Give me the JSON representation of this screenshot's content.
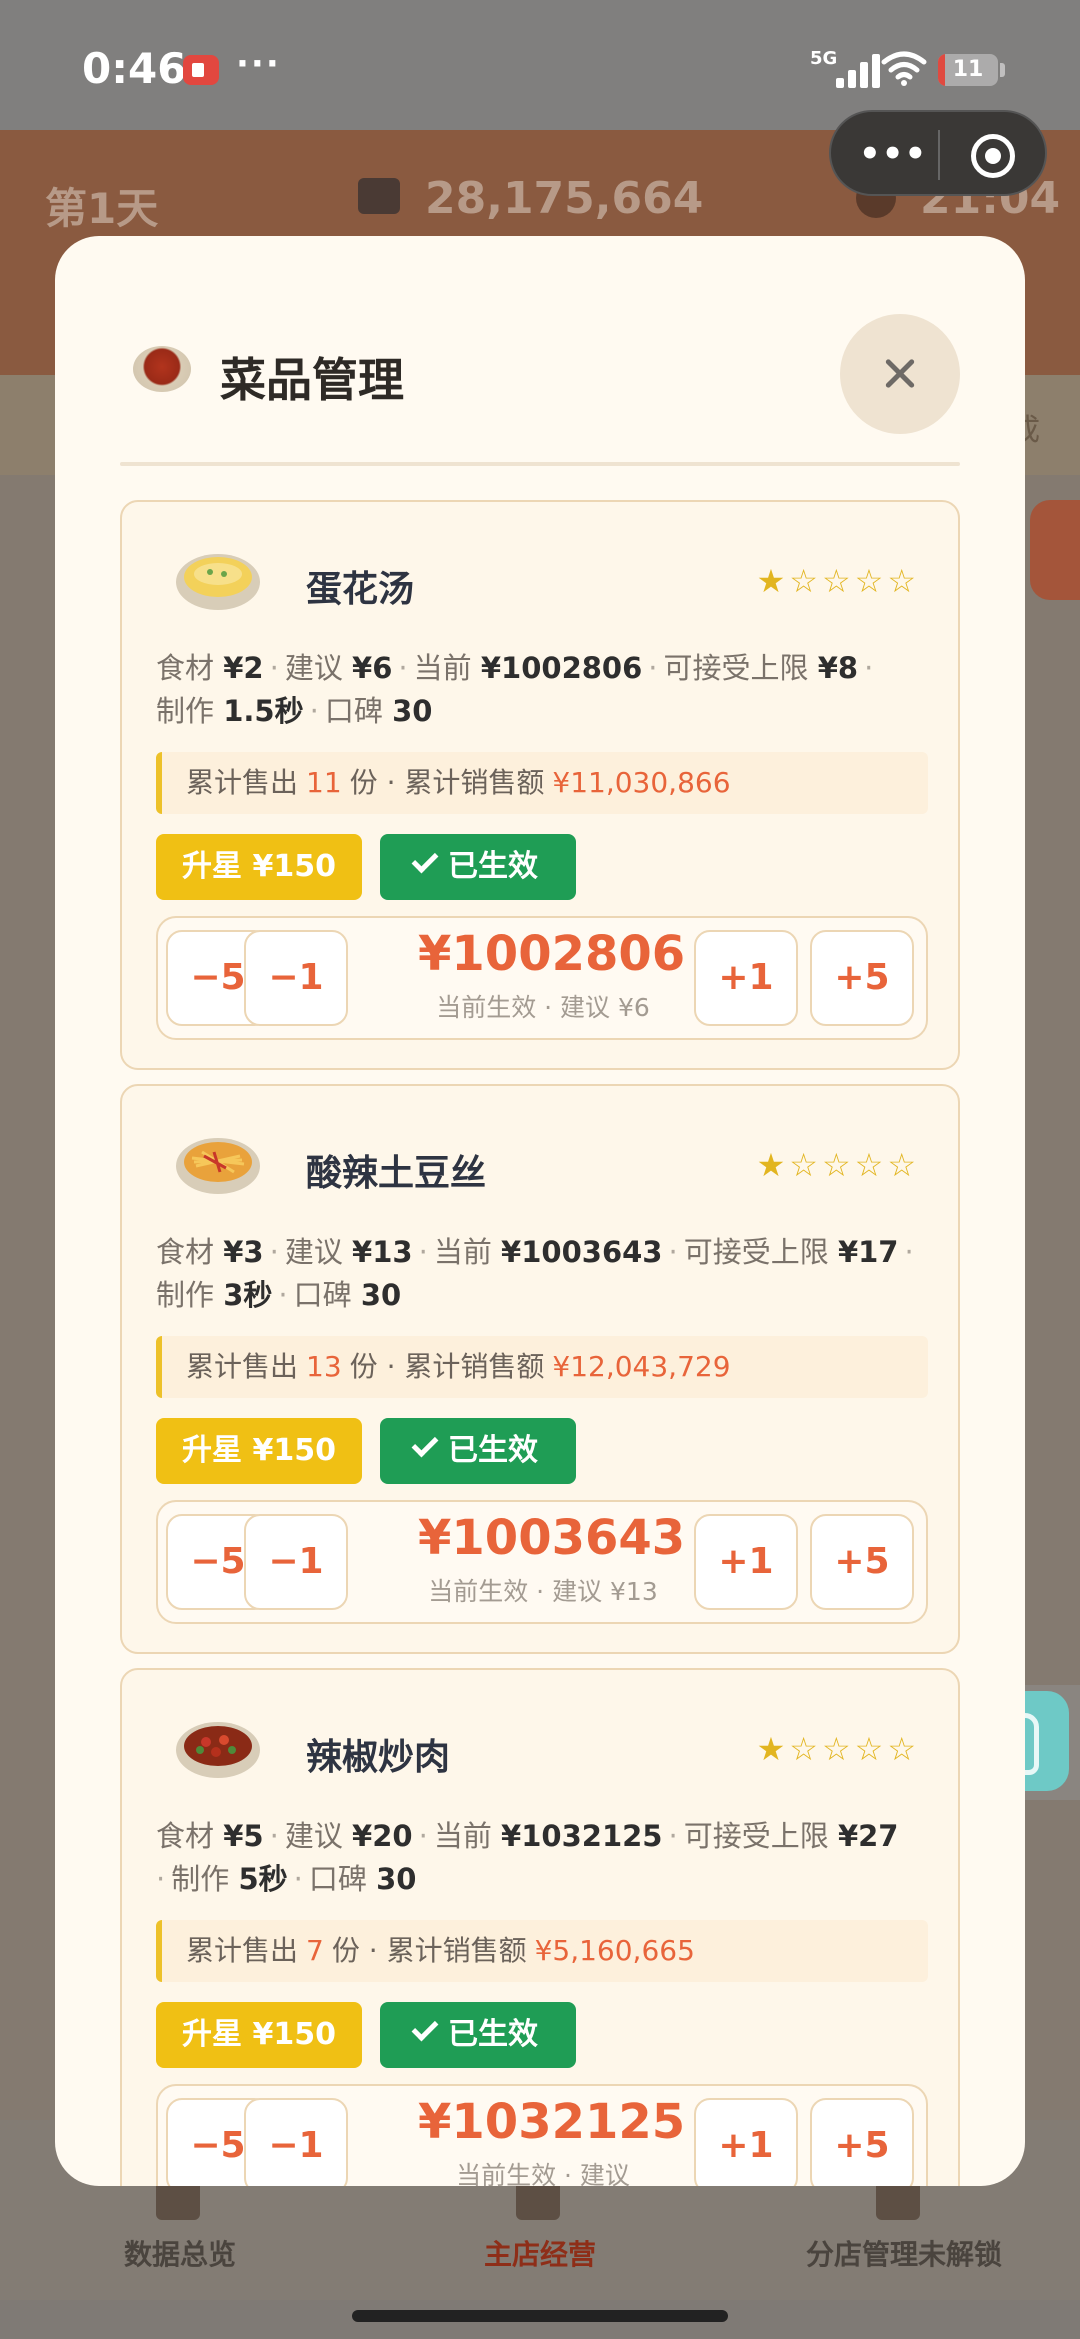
{
  "status_bar": {
    "time": "0:46",
    "network": "5G",
    "battery": "11",
    "battery_level": 0.11,
    "more": "···"
  },
  "capsule": {
    "more": "•••"
  },
  "background": {
    "day": "第1天",
    "money": "28,175,664",
    "clock": "21:04",
    "strip_text": "成",
    "tabs": [
      "数据总览",
      "主店经营",
      "分店管理未解锁"
    ]
  },
  "modal": {
    "title": "菜品管理",
    "dishes": [
      {
        "name": "蛋花汤",
        "stars": 1,
        "info_line1": [
          "食材",
          "¥2",
          "建议",
          "¥6",
          "当前",
          "¥1002806",
          "可接受上限",
          "¥8"
        ],
        "info_line2": [
          "制作",
          "1.5秒",
          "口碑",
          "30"
        ],
        "sold_label": "累计售出",
        "sold": "11",
        "sold_unit": "份",
        "revenue_label": "累计销售额",
        "revenue": "¥11,030,866",
        "upgrade": "升星 ¥150",
        "active": "已生效",
        "price": "¥1002806",
        "price_sub": "当前生效 · 建议 ¥6"
      },
      {
        "name": "酸辣土豆丝",
        "stars": 1,
        "info_line1": [
          "食材",
          "¥3",
          "建议",
          "¥13",
          "当前",
          "¥1003643",
          "可接受上限",
          "¥17"
        ],
        "info_line2": [
          "制作",
          "3秒",
          "口碑",
          "30"
        ],
        "sold_label": "累计售出",
        "sold": "13",
        "sold_unit": "份",
        "revenue_label": "累计销售额",
        "revenue": "¥12,043,729",
        "upgrade": "升星 ¥150",
        "active": "已生效",
        "price": "¥1003643",
        "price_sub": "当前生效 · 建议 ¥13"
      },
      {
        "name": "辣椒炒肉",
        "stars": 1,
        "info_line1": [
          "食材",
          "¥5",
          "建议",
          "¥20",
          "当前",
          "¥1032125",
          "可接受上限",
          "¥27"
        ],
        "info_line2": [
          "制作",
          "5秒",
          "口碑",
          "30"
        ],
        "sold_label": "累计售出",
        "sold": "7",
        "sold_unit": "份",
        "revenue_label": "累计销售额",
        "revenue": "¥5,160,665",
        "upgrade": "升星 ¥150",
        "active": "已生效",
        "price": "¥1032125",
        "price_sub": "当前生效 · 建议"
      }
    ],
    "steps": [
      "−5",
      "−1",
      "+1",
      "+5"
    ]
  },
  "colors": {
    "accent": "#e8643a",
    "upgrade": "#f0c014",
    "active": "#1f9d55",
    "star": "#e2b520"
  }
}
